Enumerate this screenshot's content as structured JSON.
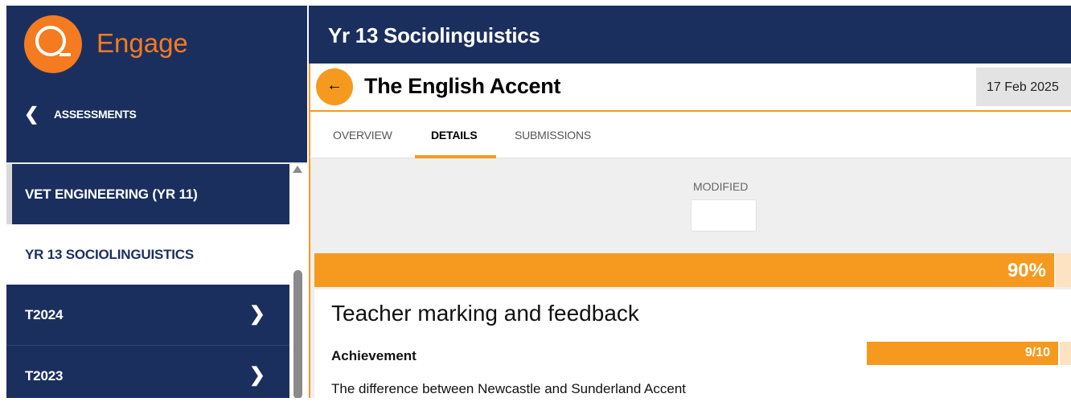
{
  "brand": {
    "name": "Engage",
    "accent": "#f47b20"
  },
  "sidebar": {
    "back_label": "ASSESSMENTS",
    "items": [
      {
        "label": "VET ENGINEERING (YR 11)",
        "has_chevron": false
      },
      {
        "label": "YR 13 SOCIOLINGUISTICS",
        "selected": true,
        "has_chevron": false
      },
      {
        "label": "T2024",
        "has_chevron": true
      },
      {
        "label": "T2023",
        "has_chevron": true
      }
    ],
    "bg_color": "#1b2f5e"
  },
  "header": {
    "course_title": "Yr 13 Sociolinguistics"
  },
  "assessment": {
    "title": "The English Accent",
    "date": "17 Feb 2025"
  },
  "tabs": [
    {
      "label": "OVERVIEW"
    },
    {
      "label": "DETAILS",
      "active": true
    },
    {
      "label": "SUBMISSIONS"
    }
  ],
  "details": {
    "modified_label": "MODIFIED",
    "modified_value": "",
    "overall_percent_label": "90%",
    "overall_fraction": 0.9,
    "section_title": "Teacher marking and feedback",
    "achievement_label": "Achievement",
    "achievement_score": "9/10",
    "achievement_fraction": 0.9,
    "description": "The difference between Newcastle and Sunderland Accent"
  },
  "icons": {
    "back": "chevron-left-icon",
    "arrow": "arrow-left-icon",
    "chevron": "chevron-right-icon"
  },
  "colors": {
    "orange": "#f59a1e",
    "navy": "#1b2f5e"
  }
}
